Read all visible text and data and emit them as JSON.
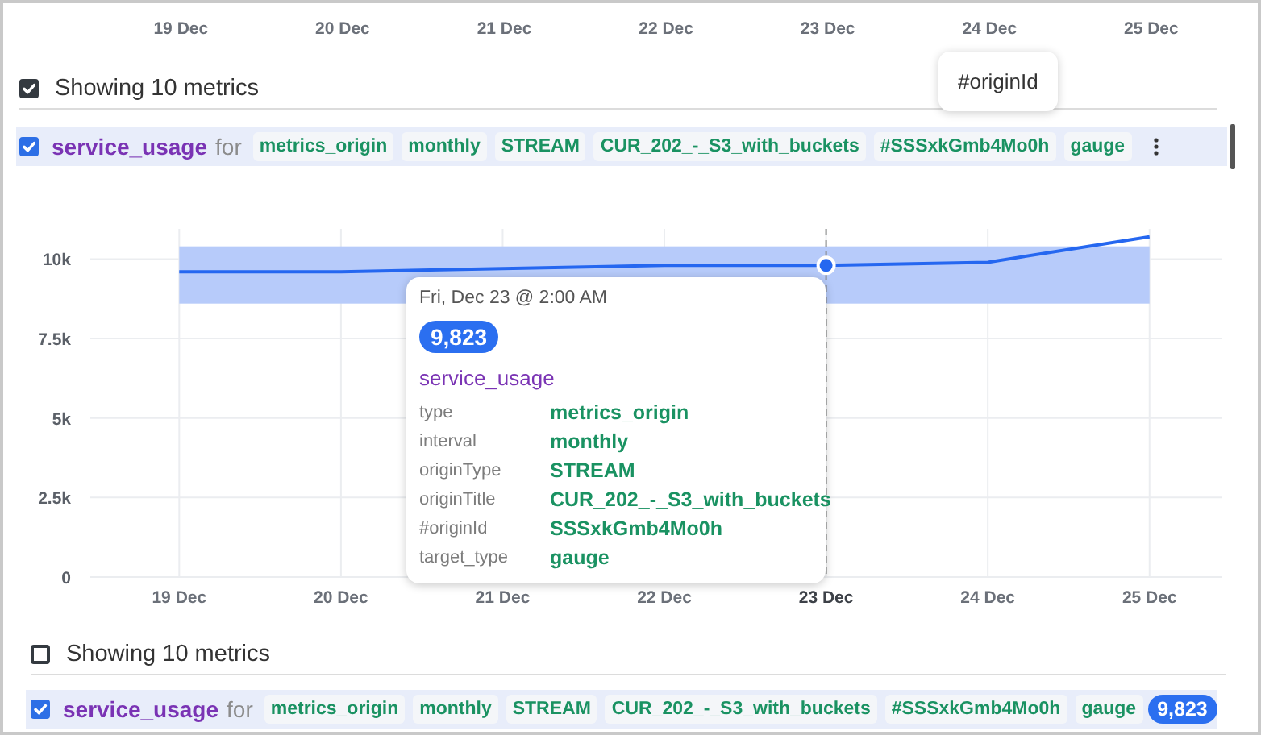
{
  "top_axis": {
    "labels": [
      "19 Dec",
      "20 Dec",
      "21 Dec",
      "22 Dec",
      "23 Dec",
      "24 Dec",
      "25 Dec"
    ]
  },
  "hover_tooltip": {
    "text": "#originId"
  },
  "top_group": {
    "header": {
      "label": "Showing 10 metrics",
      "checked": true
    },
    "row": {
      "checked": true,
      "name": "service_usage",
      "connector": "for",
      "tags": [
        "metrics_origin",
        "monthly",
        "STREAM",
        "CUR_202_-_S3_with_buckets",
        "#SSSxkGmb4Mo0h",
        "gauge"
      ],
      "menu": true
    }
  },
  "chart": {
    "tooltip": {
      "time": "Fri, Dec 23 @ 2:00 AM",
      "value": "9,823",
      "metric": "service_usage",
      "fields": [
        {
          "label": "type",
          "value": "metrics_origin"
        },
        {
          "label": "interval",
          "value": "monthly"
        },
        {
          "label": "originType",
          "value": "STREAM"
        },
        {
          "label": "originTitle",
          "value": "CUR_202_-_S3_with_buckets"
        },
        {
          "label": "#originId",
          "value": "SSSxkGmb4Mo0h"
        },
        {
          "label": "target_type",
          "value": "gauge"
        }
      ]
    },
    "points": [
      {
        "selected": false
      },
      {
        "selected": false
      },
      {
        "selected": false
      },
      {
        "selected": false
      },
      {
        "selected": true
      },
      {
        "selected": false
      },
      {
        "selected": false
      }
    ],
    "chart_data": {
      "type": "line",
      "grid": true,
      "categories": [
        "19 Dec",
        "20 Dec",
        "21 Dec",
        "22 Dec",
        "23 Dec",
        "24 Dec",
        "25 Dec"
      ],
      "series": [
        {
          "color": "#2567f0",
          "values": [
            9600,
            9600,
            9700,
            9800,
            9800,
            9900,
            10700
          ]
        }
      ],
      "ylim": [
        0,
        11000
      ],
      "bands": [
        {
          "axis": "y",
          "from": 8600,
          "to": 10400,
          "color": "#b7cbfa"
        }
      ],
      "ref_lines": [
        {
          "axis": "x",
          "value": "23 Dec",
          "color": "#888888"
        }
      ],
      "yticks": [
        0,
        {
          "value": 2500,
          "label": "2.5k"
        },
        {
          "value": 5000,
          "label": "5k"
        },
        {
          "value": 7500,
          "label": "7.5k"
        },
        {
          "value": 10000,
          "label": "10k"
        }
      ]
    }
  },
  "bottom_group": {
    "header": {
      "label": "Showing 10 metrics",
      "checked": false
    },
    "row": {
      "checked": true,
      "name": "service_usage",
      "connector": "for",
      "tags": [
        "metrics_origin",
        "monthly",
        "STREAM",
        "CUR_202_-_S3_with_buckets",
        "#SSSxkGmb4Mo0h",
        "gauge"
      ],
      "menu": false,
      "value_badge": "9,823"
    }
  }
}
